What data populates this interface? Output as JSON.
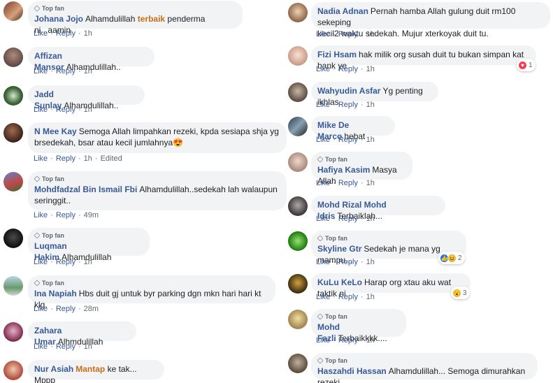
{
  "labels": {
    "top_fan": "Top fan",
    "like": "Like",
    "reply": "Reply",
    "edited": "Edited",
    "dot": "·"
  },
  "left": [
    {
      "author": "Johana Jojo",
      "text_pre": "Alhamdulillah ",
      "highlight": "terbaik",
      "text_post": " penderma ni...aamin",
      "time": "1h",
      "top_fan": true
    },
    {
      "author": "Affizan Mansor",
      "text_pre": "Alhamdulillah..",
      "time": "1h"
    },
    {
      "author": "Jadd Sunlay",
      "text_pre": "Alhamdulillah..",
      "time": "1h"
    },
    {
      "author": "N Mee Kay",
      "text_pre": "Semoga Allah limpahkan rezeki, kpda sesiapa shja yg",
      "text_line2": "brsedekah, bsar atau kecil jumlahnya😍",
      "time": "1h",
      "edited": true
    },
    {
      "author": "Mohdfadzal Bin Ismail Fbi",
      "text_pre": "Alhamdulillah..sedekah lah walaupun",
      "text_line2": "seringgit..",
      "time": "49m",
      "top_fan": true
    },
    {
      "author": "Luqman Hakim",
      "text_pre": "Alhamdulillah",
      "time": "1h",
      "top_fan": true
    },
    {
      "author": "Ina Napiah",
      "text_pre": "Hbs duit gj untuk byr parking dgn mkn hari hari kt klg.",
      "time": "28m",
      "top_fan": true
    },
    {
      "author": "Zahara Umar",
      "text_pre": "Alhmdulillah",
      "time": "1h"
    },
    {
      "author": "Nur Asiah",
      "highlight": "Mantap",
      "text_post": " ke tak... Mppp"
    }
  ],
  "right": [
    {
      "author": "Nadia Adnan",
      "text_pre": "Pernah hamba Allah gulung duit rm100 sekeping",
      "text_line2": "kecil2 waktu sedekah. Mujur xterkoyak duit tu.",
      "time": "1h"
    },
    {
      "author": "Fizi Hsam",
      "text_pre": "hak milik org susah duit tu bukan simpan kat bank ye",
      "time": "1h",
      "reaction_count": "1"
    },
    {
      "author": "Wahyudin Asfar",
      "text_pre": "Yg penting ikhlas",
      "time": "1h"
    },
    {
      "author": "Mike De Marco",
      "text_pre": "hebat",
      "time": "1h"
    },
    {
      "author": "Hafiya Kasim",
      "text_pre": "Masya Allah",
      "time": "1h",
      "top_fan": true
    },
    {
      "author": "Mohd Rizal Mohd Idris",
      "text_pre": "Terbaiklah...",
      "time": "1h"
    },
    {
      "author": "Skyline Gtr",
      "text_pre": "Sedekah je mana yg mampu...",
      "time": "1h",
      "top_fan": true,
      "reaction_count": "2"
    },
    {
      "author": "KuLu KeLo",
      "text_pre": "Harap org xtau aku wat taktik ni",
      "time": "1h",
      "reaction_count": "3"
    },
    {
      "author": "Mohd Fazli",
      "text_pre": "Terbaikkkk....",
      "time": "1h",
      "top_fan": true
    },
    {
      "author": "Haszahdi Hassan",
      "text_pre": "Alhamdulillah... Semoga dimurahkan rezeki...",
      "top_fan": true
    }
  ],
  "colors": {
    "author": "#385898",
    "highlight": "#c86e1a",
    "bubble": "#f2f3f5",
    "meta": "#606770"
  }
}
